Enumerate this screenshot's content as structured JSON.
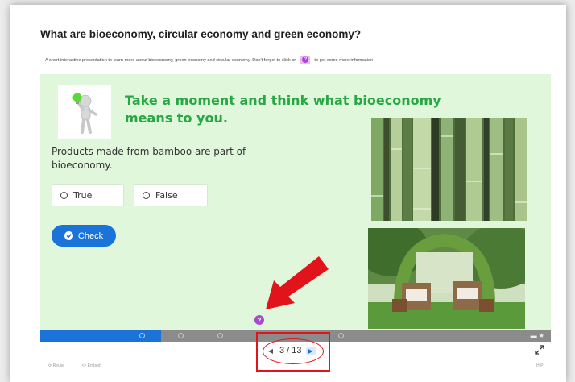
{
  "content": {
    "title": "What are bioeconomy, circular economy and green economy?",
    "subtitle_before": "A short interactive presentation to learn more about bioeconomy, green economy and circular economy. Don't forget to click on",
    "subtitle_after": "to get some more information",
    "info_icon_glyph": "?"
  },
  "slide": {
    "heading": "Take a moment and think what bioeconomy means to you.",
    "question": "Products made from bamboo are part of bioeconomy.",
    "options": [
      {
        "label": "True"
      },
      {
        "label": "False"
      }
    ],
    "check_label": "Check",
    "images": [
      "bamboo-photo",
      "garden-chairs-photo"
    ]
  },
  "navigation": {
    "progress_current": 3,
    "progress_total": 13,
    "pager_text": "3 / 13",
    "prev_glyph": "◀",
    "next_glyph": "▶"
  },
  "footer": {
    "reuse_label": "Reuse",
    "embed_label": "<> Embed",
    "right_label": "H-P"
  },
  "colors": {
    "slide_bg": "#e0f7dc",
    "heading_green": "#28a744",
    "accent_blue": "#1a73d9",
    "annotation_red": "#e0141a",
    "info_purple": "#a74ad1"
  }
}
